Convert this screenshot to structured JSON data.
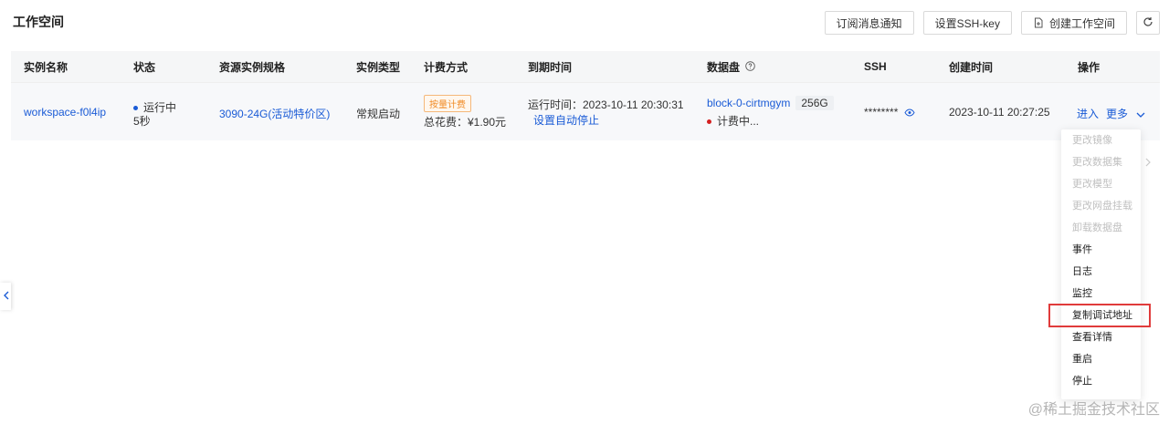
{
  "page": {
    "title": "工作空间"
  },
  "toolbar": {
    "subscribe_label": "订阅消息通知",
    "ssh_key_label": "设置SSH-key",
    "create_label": "创建工作空间"
  },
  "table": {
    "headers": [
      "实例名称",
      "状态",
      "资源实例规格",
      "实例类型",
      "计费方式",
      "到期时间",
      "数据盘",
      "SSH",
      "创建时间",
      "操作"
    ],
    "row": {
      "name": "workspace-f0l4ip",
      "status": "运行中",
      "status_duration": "5秒",
      "spec": "3090-24G(活动特价区)",
      "type": "常规启动",
      "billing_tag": "按量计费",
      "total_cost": "总花费：¥1.90元",
      "run_time": "运行时间：2023-10-11 20:30:31",
      "auto_stop": "设置自动停止",
      "disk_name": "block-0-cirtmgym",
      "disk_size": "256G",
      "disk_status": "计费中...",
      "ssh_mask": "********",
      "created_at": "2023-10-11 20:27:25",
      "op_enter": "进入",
      "op_more": "更多"
    }
  },
  "more_menu": {
    "items": [
      {
        "label": "更改镜像",
        "enabled": false
      },
      {
        "label": "更改数据集",
        "enabled": false
      },
      {
        "label": "更改模型",
        "enabled": false
      },
      {
        "label": "更改网盘挂载",
        "enabled": false
      },
      {
        "label": "卸载数据盘",
        "enabled": false
      },
      {
        "label": "事件",
        "enabled": true
      },
      {
        "label": "日志",
        "enabled": true
      },
      {
        "label": "监控",
        "enabled": true
      },
      {
        "label": "复制调试地址",
        "enabled": true
      },
      {
        "label": "查看详情",
        "enabled": true
      },
      {
        "label": "重启",
        "enabled": true
      },
      {
        "label": "停止",
        "enabled": true
      }
    ]
  },
  "colors": {
    "link": "#1a5bd6",
    "running_dot": "#1a5bd6",
    "billing_dot": "#d42020",
    "highlight": "#e03b3b",
    "billing_tag": "#f08a24"
  },
  "watermark": "@稀土掘金技术社区"
}
